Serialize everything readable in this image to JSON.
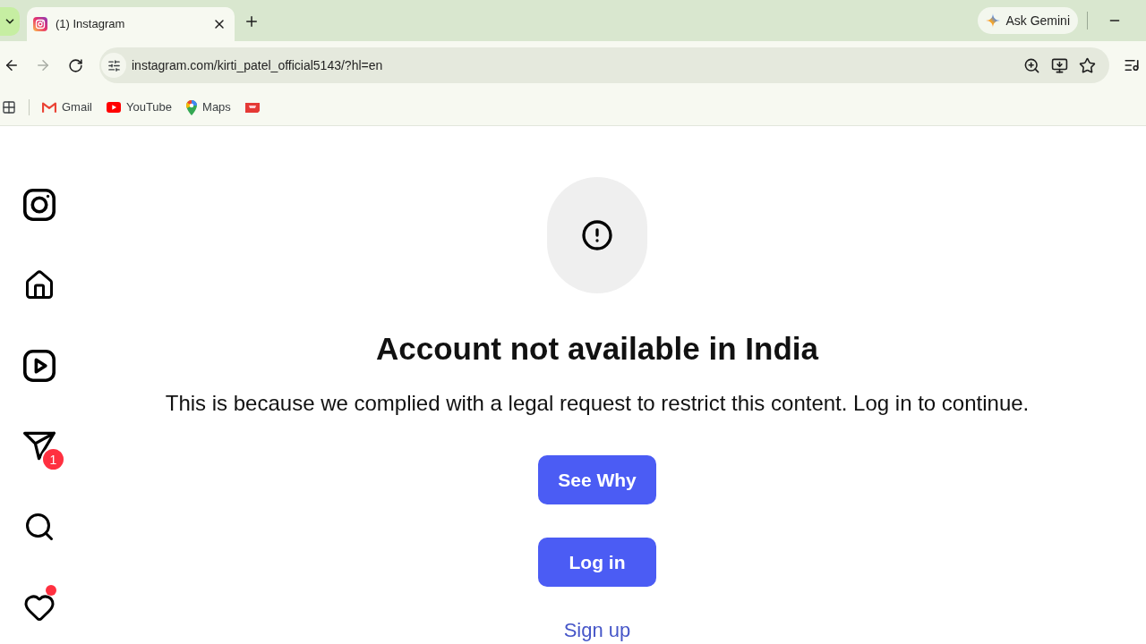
{
  "browser": {
    "tab": {
      "title": "(1) Instagram",
      "selected": true
    },
    "ask_button": {
      "label": "Ask Gemini"
    },
    "forward_button": {
      "disabled": true
    },
    "address_bar": {
      "url": "instagram.com/kirti_patel_official5143/?hl=en"
    },
    "bookmarks": [
      {
        "kind": "mail",
        "label": "Gmail"
      },
      {
        "kind": "video",
        "label": "YouTube"
      },
      {
        "kind": "pin",
        "label": "Maps"
      },
      {
        "kind": "folder"
      }
    ]
  },
  "sidebar": {
    "items": [
      {
        "kind": "logo"
      },
      {
        "kind": "home"
      },
      {
        "kind": "reels"
      },
      {
        "kind": "messages",
        "badge": "1"
      },
      {
        "kind": "search"
      },
      {
        "kind": "notifications",
        "dot": true
      }
    ]
  },
  "notice": {
    "title": "Account not available in India",
    "message": "This is because we complied with a legal request to restrict this content. Log in to continue.",
    "buttons": [
      {
        "label": "See Why"
      },
      {
        "label": "Log in"
      }
    ],
    "link": "Sign up"
  }
}
